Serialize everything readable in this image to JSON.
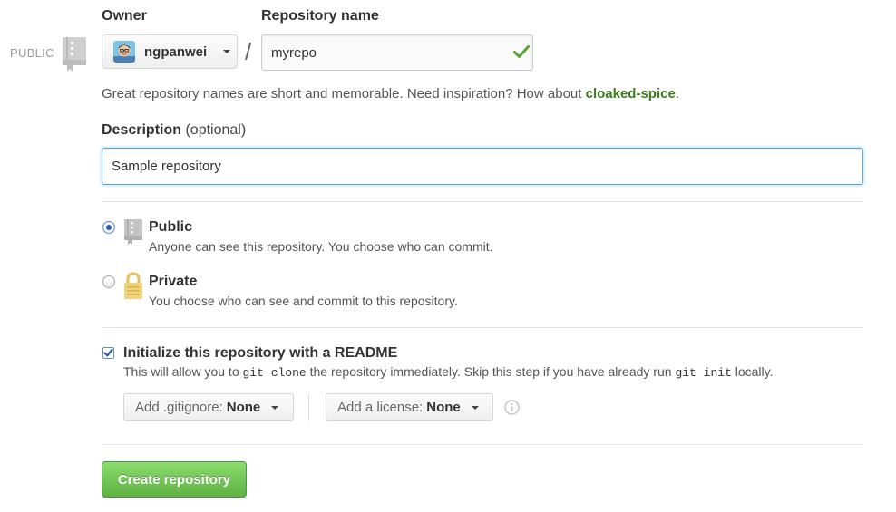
{
  "visibility_tag": "PUBLIC",
  "owner": {
    "label": "Owner",
    "selected": "ngpanwei"
  },
  "separator": "/",
  "repository": {
    "label": "Repository name",
    "value": "myrepo",
    "valid": true
  },
  "hint": {
    "text": "Great repository names are short and memorable. Need inspiration? How about ",
    "suggestion": "cloaked-spice",
    "suffix": "."
  },
  "description": {
    "label": "Description",
    "optional": "(optional)",
    "value": "Sample repository"
  },
  "visibility": {
    "selected": "public",
    "public": {
      "title": "Public",
      "description": "Anyone can see this repository. You choose who can commit."
    },
    "private": {
      "title": "Private",
      "description": "You choose who can see and commit to this repository."
    }
  },
  "init": {
    "checked": true,
    "title": "Initialize this repository with a README",
    "desc_1": "This will allow you to ",
    "code_1": "git clone",
    "desc_2": " the repository immediately. Skip this step if you have already run ",
    "code_2": "git init",
    "desc_3": " locally."
  },
  "gitignore": {
    "label": "Add .gitignore:",
    "value": "None"
  },
  "license": {
    "label": "Add a license:",
    "value": "None"
  },
  "create_button": "Create repository",
  "icons": {
    "public_tag": "repo-book-icon",
    "valid": "checkmark-icon",
    "public_option": "repo-book-icon",
    "private_option": "lock-icon",
    "info": "info-icon"
  },
  "colors": {
    "success": "#3d7a1f",
    "focus": "#51a7e8",
    "create_button": "#60b044"
  }
}
